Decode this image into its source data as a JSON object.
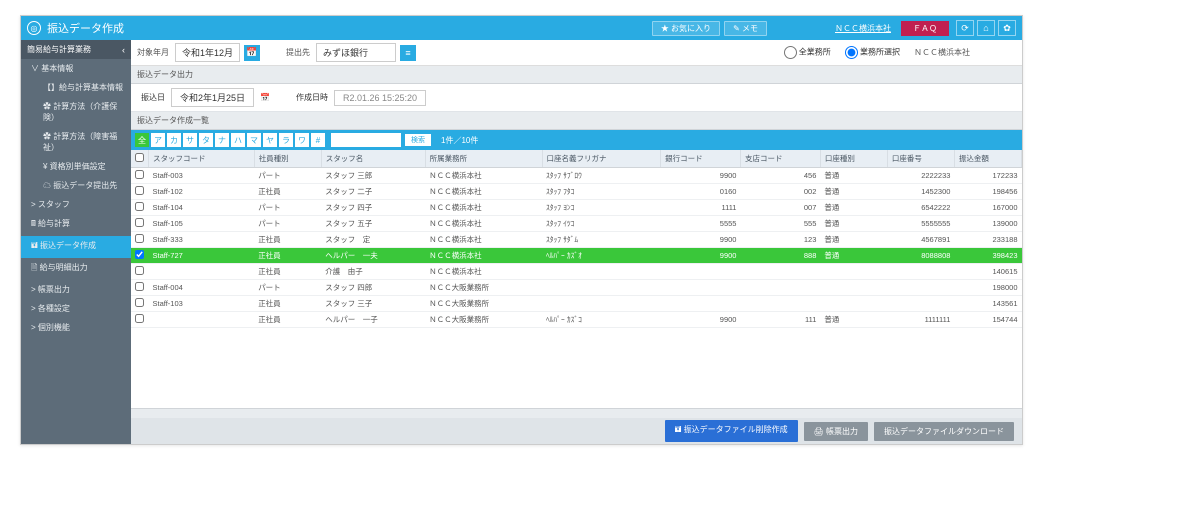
{
  "titlebar": {
    "title": "振込データ作成",
    "fav": "★ お気に入り",
    "memo": "✎ メモ",
    "company": "ＮＣＣ横浜本社",
    "faq": "ＦＡＱ"
  },
  "sidebar": {
    "header": "簡易給与計算業務",
    "items": [
      {
        "label": "∨ 基本情報",
        "cls": "l1"
      },
      {
        "label": "【】給与計算基本情報",
        "cls": "sub"
      },
      {
        "label": "✿ 計算方法（介護保険）",
        "cls": "sub"
      },
      {
        "label": "✿ 計算方法（障害福祉）",
        "cls": "sub"
      },
      {
        "label": "¥ 資格別単価設定",
        "cls": "sub"
      },
      {
        "label": "☁ 振込データ提出先",
        "cls": "sub"
      },
      {
        "label": "> スタッフ",
        "cls": "l1"
      },
      {
        "label": "🖩 給与計算",
        "cls": "l1"
      },
      {
        "label": "🖬 振込データ作成",
        "cls": "l1 active"
      },
      {
        "label": "🗎 給与明細出力",
        "cls": "l1"
      },
      {
        "label": "> 帳票出力",
        "cls": "l1"
      },
      {
        "label": "> 各種設定",
        "cls": "l1"
      },
      {
        "label": "> 個別機能",
        "cls": "l1"
      }
    ]
  },
  "filter": {
    "period_lbl": "対象年月",
    "period_val": "令和1年12月",
    "dest_lbl": "提出先",
    "dest_val": "みずほ銀行",
    "radio_all": "全業務所",
    "radio_sel": "業務所選択",
    "office": "ＮＣＣ横浜本社"
  },
  "sec1": {
    "title": "振込データ出力",
    "date_lbl": "振込日",
    "date_val": "令和2年1月25日",
    "created_lbl": "作成日時",
    "created_val": "R2.01.26 15:25:20"
  },
  "sec2": {
    "title": "振込データ作成一覧"
  },
  "kana": [
    "全",
    "ア",
    "カ",
    "サ",
    "タ",
    "ナ",
    "ハ",
    "マ",
    "ヤ",
    "ラ",
    "ワ",
    "#"
  ],
  "kana_btn": "検索",
  "pager": "1件／10件",
  "cols": [
    "",
    "スタッフコード",
    "社員種別",
    "スタッフ名",
    "所属業務所",
    "口座名義フリガナ",
    "銀行コード",
    "支店コード",
    "口座種別",
    "口座番号",
    "振込金額"
  ],
  "rows": [
    {
      "code": "Staff-003",
      "type": "パート",
      "name": "スタッフ 三郎",
      "office": "ＮＣＣ横浜本社",
      "kana": "ｽﾀｯﾌ ｻﾌﾞﾛｳ",
      "bank": "9900",
      "branch": "456",
      "acct": "普通",
      "num": "2222233",
      "amt": "172233",
      "sel": false
    },
    {
      "code": "Staff-102",
      "type": "正社員",
      "name": "スタッフ 二子",
      "office": "ＮＣＣ横浜本社",
      "kana": "ｽﾀｯﾌ ﾌﾀｺ",
      "bank": "0160",
      "branch": "002",
      "acct": "普通",
      "num": "1452300",
      "amt": "198456",
      "sel": false
    },
    {
      "code": "Staff-104",
      "type": "パート",
      "name": "スタッフ 四子",
      "office": "ＮＣＣ横浜本社",
      "kana": "ｽﾀｯﾌ ﾖﾝｺ",
      "bank": "1111",
      "branch": "007",
      "acct": "普通",
      "num": "6542222",
      "amt": "167000",
      "sel": false
    },
    {
      "code": "Staff-105",
      "type": "パート",
      "name": "スタッフ 五子",
      "office": "ＮＣＣ横浜本社",
      "kana": "ｽﾀｯﾌ ｲﾂｺ",
      "bank": "5555",
      "branch": "555",
      "acct": "普通",
      "num": "5555555",
      "amt": "139000",
      "sel": false
    },
    {
      "code": "Staff-333",
      "type": "正社員",
      "name": "スタッフ　定",
      "office": "ＮＣＣ横浜本社",
      "kana": "ｽﾀｯﾌ ｻﾀﾞﾑ",
      "bank": "9900",
      "branch": "123",
      "acct": "普通",
      "num": "4567891",
      "amt": "233188",
      "sel": false
    },
    {
      "code": "Staff-727",
      "type": "正社員",
      "name": "ヘルパー　一夫",
      "office": "ＮＣＣ横浜本社",
      "kana": "ﾍﾙﾊﾟｰ ｶｽﾞｵ",
      "bank": "9900",
      "branch": "888",
      "acct": "普通",
      "num": "8088808",
      "amt": "398423",
      "sel": true
    },
    {
      "code": "",
      "type": "正社員",
      "name": "介護　由子",
      "office": "ＮＣＣ横浜本社",
      "kana": "",
      "bank": "",
      "branch": "",
      "acct": "",
      "num": "",
      "amt": "140615",
      "sel": false
    },
    {
      "code": "Staff-004",
      "type": "パート",
      "name": "スタッフ 四郎",
      "office": "ＮＣＣ大阪業務所",
      "kana": "",
      "bank": "",
      "branch": "",
      "acct": "",
      "num": "",
      "amt": "198000",
      "sel": false
    },
    {
      "code": "Staff-103",
      "type": "正社員",
      "name": "スタッフ 三子",
      "office": "ＮＣＣ大阪業務所",
      "kana": "",
      "bank": "",
      "branch": "",
      "acct": "",
      "num": "",
      "amt": "143561",
      "sel": false
    },
    {
      "code": "",
      "type": "正社員",
      "name": "ヘルパー　一子",
      "office": "ＮＣＣ大阪業務所",
      "kana": "ﾍﾙﾊﾟｰ ｶｽﾞｺ",
      "bank": "9900",
      "branch": "111",
      "acct": "普通",
      "num": "1111111",
      "amt": "154744",
      "sel": false
    }
  ],
  "footer": {
    "btn1": "🖬 振込データファイル削除作成",
    "btn2": "🖨 帳票出力",
    "btn3": "振込データファイルダウンロード"
  }
}
